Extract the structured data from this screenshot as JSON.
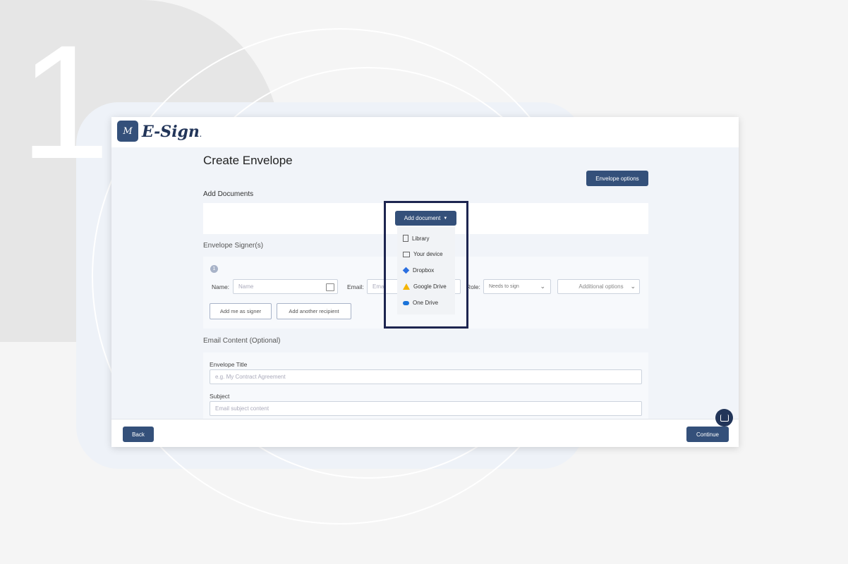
{
  "step_number": "1",
  "app": {
    "logo_mark": "M",
    "logo_text": "E-Sign",
    "logo_suffix": "."
  },
  "page": {
    "title": "Create Envelope"
  },
  "envelope_options_label": "Envelope options",
  "add_documents": {
    "label": "Add Documents",
    "button_label": "Add document",
    "menu": [
      {
        "label": "Library",
        "icon": "library-icon"
      },
      {
        "label": "Your device",
        "icon": "device-icon"
      },
      {
        "label": "Dropbox",
        "icon": "dropbox-icon"
      },
      {
        "label": "Google Drive",
        "icon": "google-drive-icon"
      },
      {
        "label": "One Drive",
        "icon": "onedrive-icon"
      }
    ]
  },
  "signers": {
    "label": "Envelope Signer(s)",
    "index": "1",
    "name_label": "Name:",
    "name_placeholder": "Name",
    "email_label": "Email:",
    "email_placeholder": "Ema",
    "role_label": "Role:",
    "role_value": "Needs to sign",
    "additional_options": "Additional options",
    "add_me_label": "Add me as signer",
    "add_recipient_label": "Add another recipient"
  },
  "email_content": {
    "label": "Email Content (Optional)",
    "title_label": "Envelope Title",
    "title_placeholder": "e.g. My Contract Agreement",
    "subject_label": "Subject",
    "subject_placeholder": "Email subject content"
  },
  "footer": {
    "back_label": "Back",
    "continue_label": "Continue"
  },
  "colors": {
    "primary": "#34507a",
    "highlight": "#1d2550"
  }
}
